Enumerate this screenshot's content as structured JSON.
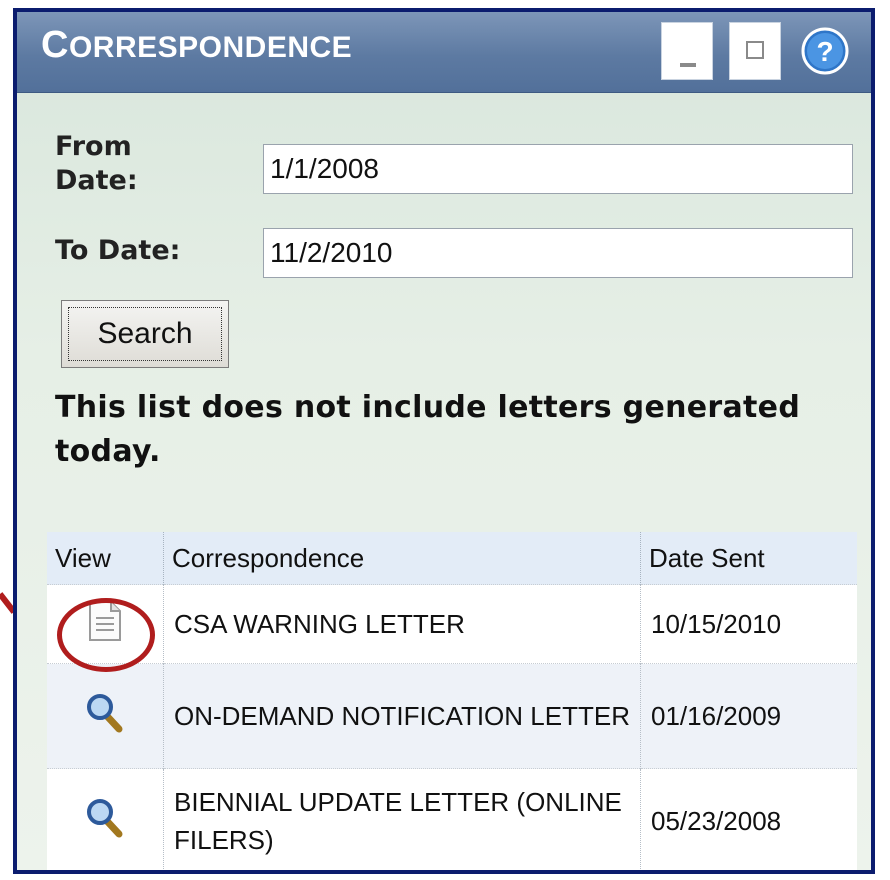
{
  "window": {
    "title_first": "C",
    "title_rest": "ORRESPONDENCE"
  },
  "form": {
    "from_label": "From Date:",
    "from_value": "1/1/2008",
    "to_label": "To Date:",
    "to_value": "11/2/2010",
    "search_label": "Search",
    "note": "This list does not include letters generated today."
  },
  "table": {
    "headers": [
      "View",
      "Correspondence",
      "Date Sent"
    ],
    "rows": [
      {
        "icon": "document-icon",
        "name": "CSA WARNING LETTER",
        "date": "10/15/2010"
      },
      {
        "icon": "magnifier-icon",
        "name": "ON-DEMAND NOTIFICATION LETTER",
        "date": "01/16/2009"
      },
      {
        "icon": "magnifier-icon",
        "name": "BIENNIAL UPDATE LETTER (ONLINE FILERS)",
        "date": "05/23/2008"
      }
    ]
  },
  "colors": {
    "titlebar": "#5d7aa2",
    "annotation": "#b01d1d",
    "border": "#0b1c6e"
  }
}
